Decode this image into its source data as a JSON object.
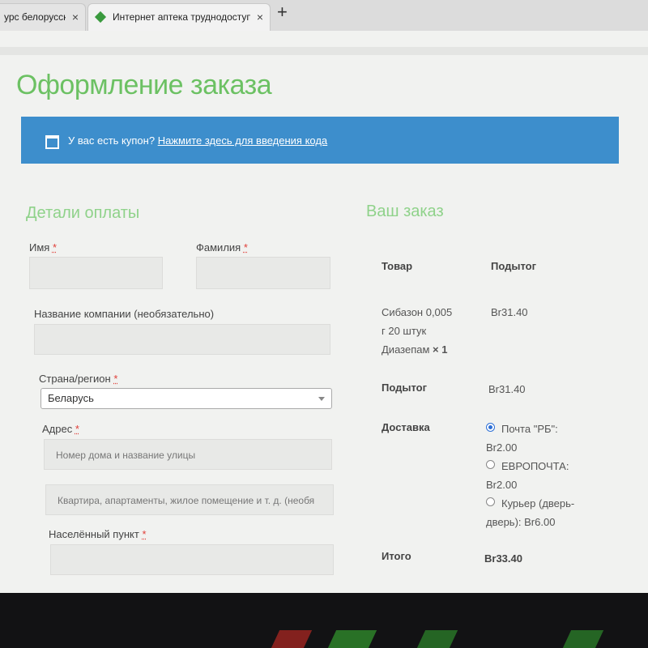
{
  "browser": {
    "tabs": [
      {
        "title": "урс белорусско"
      },
      {
        "title": "Интернет аптека труднодоступ"
      }
    ],
    "new_tab_label": "+",
    "close_label": "×"
  },
  "page": {
    "title": "Оформление заказа",
    "coupon": {
      "question": "У вас есть купон?",
      "link": "Нажмите здесь для введения кода"
    }
  },
  "billing": {
    "heading": "Детали оплаты",
    "required_mark": "*",
    "first_name_label": "Имя",
    "last_name_label": "Фамилия",
    "company_label": "Название компании (необязательно)",
    "country_label": "Страна/регион",
    "country_value": "Беларусь",
    "address_label": "Адрес",
    "address_placeholder_1": "Номер дома и название улицы",
    "address_placeholder_2": "Квартира, апартаменты, жилое помещение и т. д. (необя",
    "city_label": "Населённый пункт"
  },
  "order": {
    "heading": "Ваш заказ",
    "col_product": "Товар",
    "col_subtotal": "Подытог",
    "item": {
      "line1": "Сибазон 0,005",
      "line2": "г 20 штук",
      "line3": "Диазепам",
      "qty": "× 1",
      "price": "Br31.40"
    },
    "subtotal_label": "Подытог",
    "subtotal_value": "Br31.40",
    "shipping_label": "Доставка",
    "shipping_options": [
      {
        "line1": "Почта \"РБ\":",
        "line2": "Br2.00",
        "selected": true
      },
      {
        "line1": "ЕВРОПОЧТА:",
        "line2": "Br2.00",
        "selected": false
      },
      {
        "line1": "Курьер (дверь-",
        "line2": "дверь): Br6.00",
        "selected": false
      }
    ],
    "total_label": "Итого",
    "total_value": "Br33.40"
  },
  "colors": {
    "title_green": "#6cc163",
    "heading_green": "#8fd28a",
    "notice_blue": "#3d8ecc",
    "required_red": "#e0403a"
  }
}
